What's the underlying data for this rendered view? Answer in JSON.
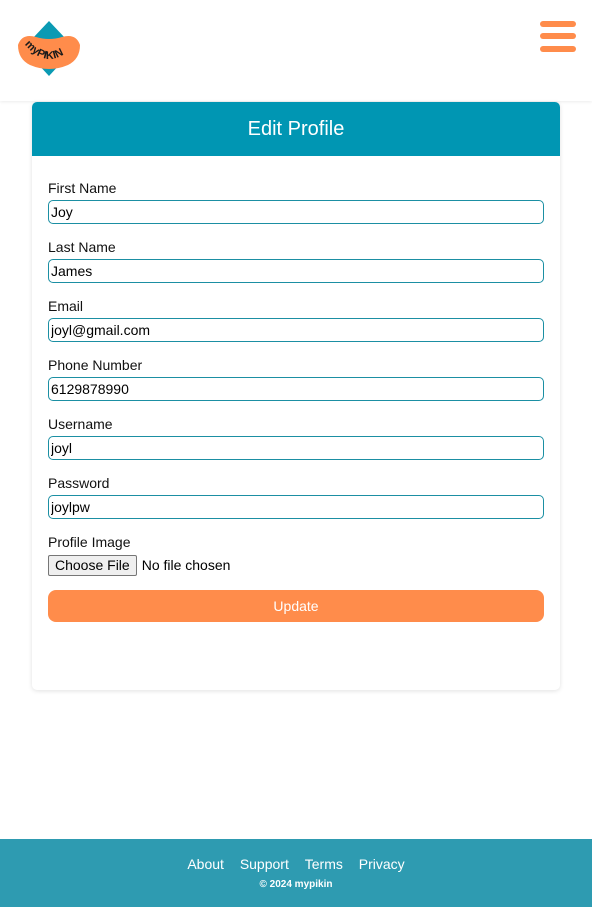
{
  "brand": {
    "logo_text": "myPIKIN",
    "primary_color": "#0096b3",
    "accent_color": "#ff8c4b"
  },
  "header": {
    "menu_icon": "hamburger-menu-icon"
  },
  "card": {
    "title": "Edit Profile"
  },
  "form": {
    "first_name": {
      "label": "First Name",
      "value": "Joy"
    },
    "last_name": {
      "label": "Last Name",
      "value": "James"
    },
    "email": {
      "label": "Email",
      "value": "joyl@gmail.com"
    },
    "phone": {
      "label": "Phone Number",
      "value": "6129878990"
    },
    "username": {
      "label": "Username",
      "value": "joyl"
    },
    "password": {
      "label": "Password",
      "value": "joylpw"
    },
    "profile_image": {
      "label": "Profile Image",
      "button_label": "Choose File",
      "status": "No file chosen"
    },
    "submit_label": "Update"
  },
  "footer": {
    "links": [
      "About",
      "Support",
      "Terms",
      "Privacy"
    ],
    "copyright": "© 2024 mypikin"
  }
}
